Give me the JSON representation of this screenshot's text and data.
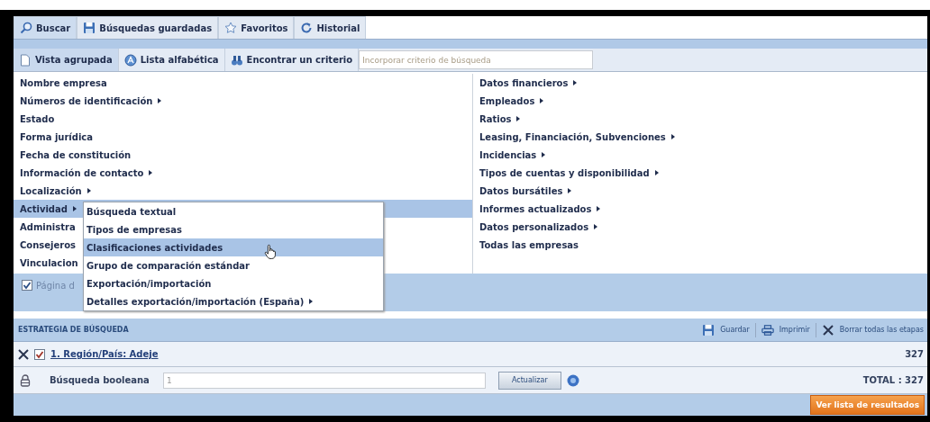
{
  "search_tabs": [
    {
      "label": "Buscar",
      "selected": true
    },
    {
      "label": "Búsquedas guardadas",
      "selected": false
    },
    {
      "label": "Favoritos",
      "selected": false
    },
    {
      "label": "Historial",
      "selected": false
    }
  ],
  "view_tabs": [
    {
      "label": "Vista agrupada",
      "selected": true
    },
    {
      "label": "Lista alfabética",
      "selected": false
    },
    {
      "label": "Encontrar un criterio",
      "selected": false
    }
  ],
  "criterion_search": {
    "placeholder": "Incorporar criterio de búsqueda"
  },
  "criteria_left": [
    {
      "label": "Nombre empresa",
      "submenu": false,
      "selected": false
    },
    {
      "label": "Números de identificación",
      "submenu": true,
      "selected": false
    },
    {
      "label": "Estado",
      "submenu": false,
      "selected": false
    },
    {
      "label": "Forma jurídica",
      "submenu": false,
      "selected": false
    },
    {
      "label": "Fecha de constitución",
      "submenu": false,
      "selected": false
    },
    {
      "label": "Información de contacto",
      "submenu": true,
      "selected": false
    },
    {
      "label": "Localización",
      "submenu": true,
      "selected": false
    },
    {
      "label": "Actividad",
      "submenu": true,
      "selected": true
    },
    {
      "label": "Administra",
      "selected": false
    },
    {
      "label": "Consejeros",
      "selected": false
    },
    {
      "label": "Vinculacion",
      "selected": false
    }
  ],
  "criteria_right": [
    {
      "label": "Datos financieros",
      "submenu": true,
      "selected": false
    },
    {
      "label": "Empleados",
      "submenu": true,
      "selected": false
    },
    {
      "label": "Ratios",
      "submenu": true,
      "selected": false
    },
    {
      "label": "Leasing, Financiación, Subvenciones",
      "submenu": true,
      "selected": false
    },
    {
      "label": "Incidencias",
      "submenu": true,
      "selected": false
    },
    {
      "label": "Tipos de cuentas y disponibilidad",
      "submenu": true,
      "selected": false
    },
    {
      "label": "Datos bursátiles",
      "submenu": true,
      "selected": false
    },
    {
      "label": "Informes actualizados",
      "submenu": true,
      "selected": false
    },
    {
      "label": "Datos personalizados",
      "submenu": true,
      "selected": false
    },
    {
      "label": "Todas las empresas",
      "submenu": false,
      "selected": false
    }
  ],
  "activity_menu": [
    {
      "label": "Búsqueda textual",
      "submenu": false,
      "selected": false
    },
    {
      "label": "Tipos de empresas",
      "submenu": false,
      "selected": false
    },
    {
      "label": "Clasificaciones actividades",
      "submenu": false,
      "selected": true
    },
    {
      "label": "Grupo de comparación estándar",
      "submenu": false,
      "selected": false
    },
    {
      "label": "Exportación/importación",
      "submenu": false,
      "selected": false
    },
    {
      "label": "Detalles exportación/importación (España)",
      "submenu": true,
      "selected": false
    }
  ],
  "page_option": {
    "label": "Página d",
    "checked": true
  },
  "strategy": {
    "title": "ESTRATEGIA DE BÚSQUEDA",
    "actions": [
      "Guardar",
      "Imprimir",
      "Borrar todas las etapas"
    ],
    "steps": [
      {
        "label": "1. Región/País: Adeje",
        "checked": true,
        "count": "327"
      }
    ],
    "boolean_search": {
      "label": "Búsqueda booleana",
      "value": "1",
      "button": "Actualizar"
    },
    "total": "TOTAL : 327"
  },
  "results_button": "Ver lista de resultados"
}
